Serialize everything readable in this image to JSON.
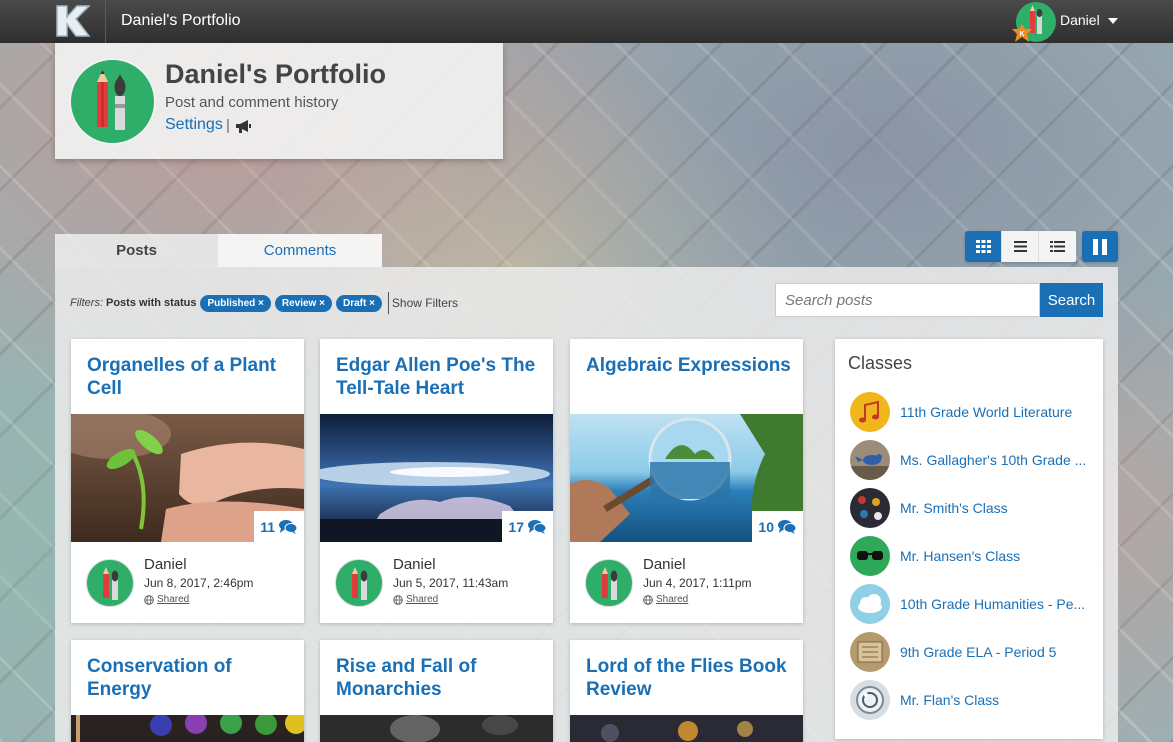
{
  "topbar": {
    "brand_title": "Daniel's Portfolio",
    "user_name": "Daniel",
    "logo_letter": "K"
  },
  "header": {
    "title": "Daniel's Portfolio",
    "subtitle": "Post and comment history",
    "settings_label": "Settings",
    "separator": "|"
  },
  "tabs": [
    {
      "label": "Posts",
      "active": true
    },
    {
      "label": "Comments",
      "active": false
    }
  ],
  "view_modes": [
    {
      "icon": "grid-icon",
      "active": true
    },
    {
      "icon": "list-icon",
      "active": false
    },
    {
      "icon": "detail-list-icon",
      "active": false
    }
  ],
  "filters": {
    "label": "Filters:",
    "status_label": "Posts with status",
    "pills": [
      "Published ×",
      "Review ×",
      "Draft ×"
    ],
    "show_filters": "Show Filters"
  },
  "search": {
    "placeholder": "Search posts",
    "button_label": "Search"
  },
  "posts": [
    {
      "title": "Organelles of a Plant Cell",
      "comments": "11",
      "author": "Daniel",
      "date": "Jun 8, 2017, 2:46pm",
      "visibility": "Shared"
    },
    {
      "title": "Edgar Allen Poe's The Tell-Tale Heart",
      "comments": "17",
      "author": "Daniel",
      "date": "Jun 5, 2017, 11:43am",
      "visibility": "Shared"
    },
    {
      "title": "Algebraic Expressions",
      "comments": "10",
      "author": "Daniel",
      "date": "Jun 4, 2017, 1:11pm",
      "visibility": "Shared"
    },
    {
      "title": "Conservation of Energy"
    },
    {
      "title": "Rise and Fall of Monarchies"
    },
    {
      "title": "Lord of the Flies Book Review"
    }
  ],
  "classes": {
    "title": "Classes",
    "items": [
      {
        "name": "11th Grade World Literature",
        "icon": "music-note-icon",
        "color": "#f2b61d"
      },
      {
        "name": "Ms. Gallagher's 10th Grade ...",
        "icon": "bird-icon",
        "color": "#8a7a6a"
      },
      {
        "name": "Mr. Smith's Class",
        "icon": "abacus-icon",
        "color": "#2b2b35"
      },
      {
        "name": "Mr. Hansen's Class",
        "icon": "glasses-icon",
        "color": "#2fa85a"
      },
      {
        "name": "10th Grade Humanities - Pe...",
        "icon": "cloud-icon",
        "color": "#8fd0e6"
      },
      {
        "name": "9th Grade ELA - Period 5",
        "icon": "books-icon",
        "color": "#b59a6e"
      },
      {
        "name": "Mr. Flan's Class",
        "icon": "glass-sphere-icon",
        "color": "#d8dde2"
      }
    ]
  },
  "colors": {
    "accent": "#1a6fb5",
    "avatar_green": "#2fae6a",
    "topbar": "#3a3a3a"
  }
}
